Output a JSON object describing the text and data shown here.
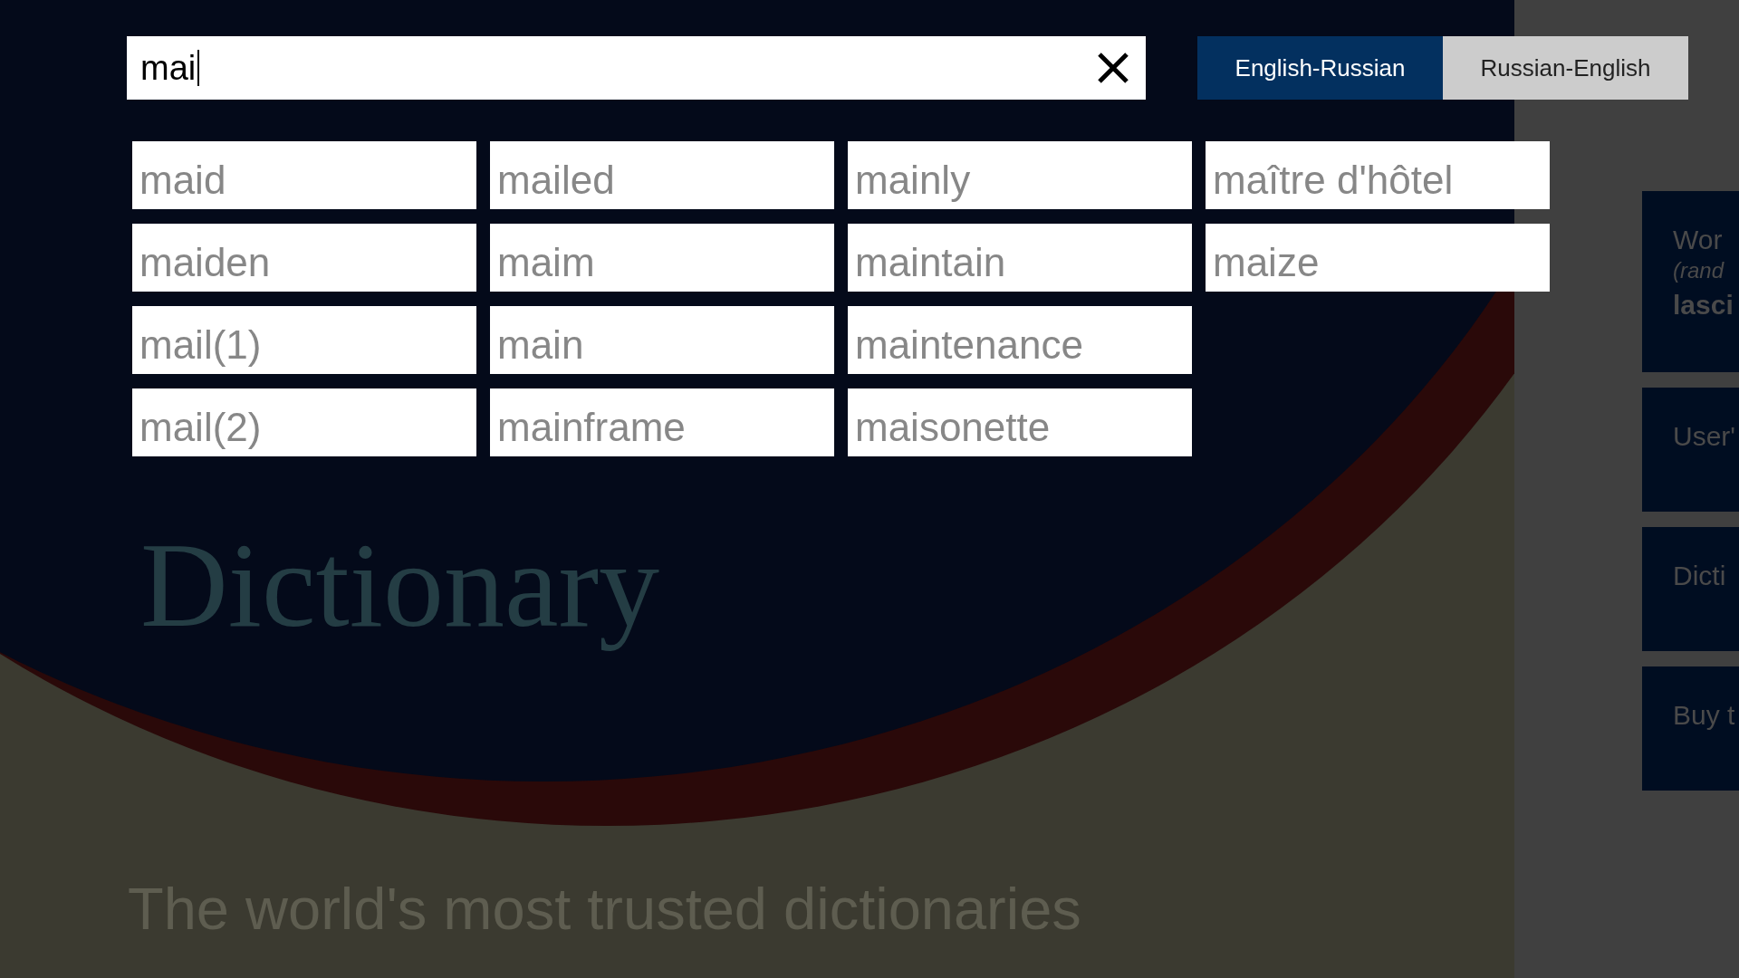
{
  "search": {
    "value": "mai"
  },
  "language_toggle": [
    {
      "label": "English-Russian",
      "selected": true
    },
    {
      "label": "Russian-English",
      "selected": false
    }
  ],
  "suggestions": [
    "maid",
    "maiden",
    "mail(1)",
    "mail(2)",
    "mailed",
    "maim",
    "main",
    "mainframe",
    "mainly",
    "maintain",
    "maintenance",
    "maisonette",
    "maître d'hôtel",
    "maize"
  ],
  "splash": {
    "title": "Dictionary",
    "tagline": "The world's most trusted dictionaries"
  },
  "side_tiles": [
    {
      "title": "Wor",
      "subtitle": "(rand",
      "word": "lasci"
    },
    {
      "title": "User'"
    },
    {
      "title": "Dicti"
    },
    {
      "title": "Buy t"
    }
  ]
}
